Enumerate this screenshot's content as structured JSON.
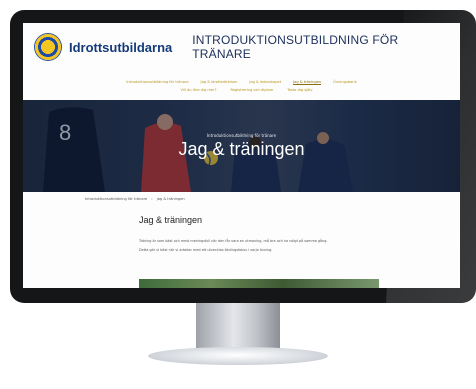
{
  "header": {
    "brand_name": "Idrottsutbildarna",
    "site_title": "INTRODUKTIONSUTBILDNING FÖR TRÄNARE"
  },
  "nav": {
    "row1": [
      {
        "label": "Introduktionsutbildning för tränare"
      },
      {
        "label": "Jag & idrottsrörelsen"
      },
      {
        "label": "Jag & ledarskapet"
      },
      {
        "label": "Jag & träningen",
        "active": true
      },
      {
        "label": "Övningsbank"
      }
    ],
    "row2": [
      {
        "label": "Vill du lära dig mer?"
      },
      {
        "label": "Registrering och diplom"
      },
      {
        "label": "Testa dig själv"
      }
    ]
  },
  "hero": {
    "kicker": "Introduktionsutbildning för tränare",
    "title": "Jag & träningen"
  },
  "breadcrumb": [
    "Introduktionsutbildning för tränare",
    "›",
    "Jag & träningen"
  ],
  "content": {
    "heading": "Jag & träningen",
    "intro_line1": "Träning är som bäst och mest meningsfull när den får vara en utmaning, må bra och ha roligt på samma gång.",
    "intro_line2": "Detta gör vi bäst när vi arbetar med ett utvecklas tävlingsfokus i varje övning."
  },
  "colors": {
    "nav_link": "#b69417",
    "brand_blue": "#143a7a",
    "monitor_bezel": "#151617"
  }
}
